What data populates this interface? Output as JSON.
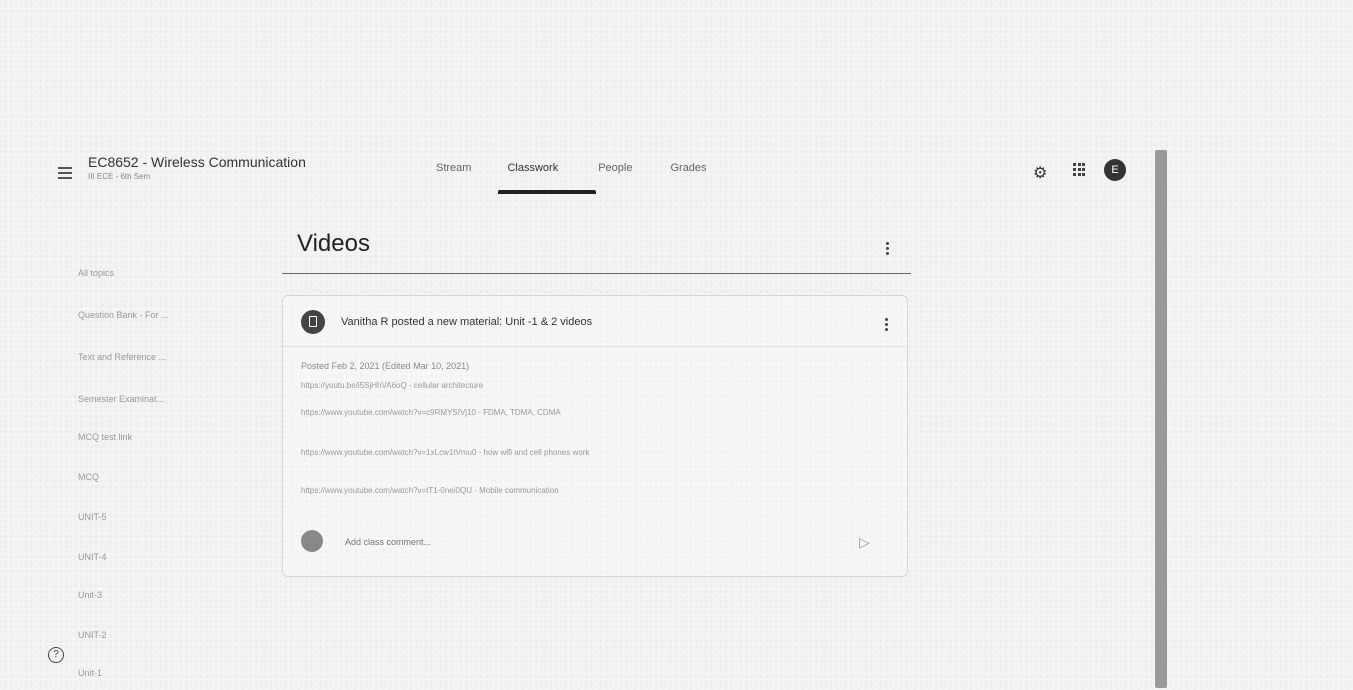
{
  "header": {
    "class_title": "EC8652 - Wireless Communication",
    "class_subtitle": "III ECE - 6th Sem",
    "tabs": [
      {
        "label": "Stream"
      },
      {
        "label": "Classwork"
      },
      {
        "label": "People"
      },
      {
        "label": "Grades"
      }
    ],
    "active_tab": "Classwork",
    "avatar_letter": "E",
    "icons": [
      "menu-icon",
      "gear-icon",
      "apps-grid-icon",
      "help-icon"
    ]
  },
  "sidebar": {
    "items": [
      {
        "label": "All topics"
      },
      {
        "label": "Question Bank - For ..."
      },
      {
        "label": "Text and Reference ..."
      },
      {
        "label": "Semester Examinat..."
      },
      {
        "label": "MCQ test link"
      },
      {
        "label": "MCQ"
      },
      {
        "label": "UNIT-5"
      },
      {
        "label": "UNIT-4"
      },
      {
        "label": "Unit-3"
      },
      {
        "label": "UNIT-2"
      },
      {
        "label": "Unit-1"
      }
    ]
  },
  "topic": {
    "title": "Videos"
  },
  "material": {
    "heading": "Vanitha R posted a new material: Unit -1 & 2 videos",
    "posted": "Posted Feb 2, 2021 (Edited Mar 10, 2021)",
    "lines": [
      "https://youtu.be/i5SjHhVA6oQ - cellular architecture",
      "https://www.youtube.com/watch?v=c9RMYSIVj10 - FDMA, TDMA, CDMA",
      "https://www.youtube.com/watch?v=1xLcw1tVmu0 - how wifi and cell phones work",
      "https://www.youtube.com/watch?v=tT1-0nei0QU - Mobile communication"
    ],
    "comment_placeholder": "Add class comment..."
  }
}
